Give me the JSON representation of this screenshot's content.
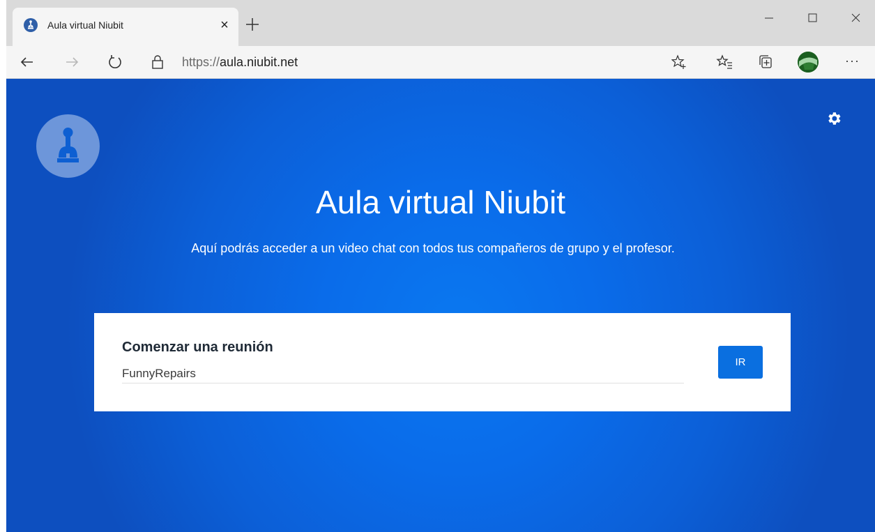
{
  "browser": {
    "tab_title": "Aula virtual Niubit",
    "tab_close": "×",
    "url_scheme": "https://",
    "url_host": "aula.niubit.net",
    "toolbar_more": "···",
    "icons": [
      "tab-favicon-icon",
      "close-icon",
      "plus-icon",
      "minimize-icon",
      "maximize-icon",
      "window-close-icon",
      "back-icon",
      "forward-icon",
      "refresh-icon",
      "lock-icon",
      "add-favorite-icon",
      "favorites-icon",
      "collections-icon",
      "avatar",
      "more-icon"
    ]
  },
  "page": {
    "title": "Aula virtual Niubit",
    "subtitle": "Aquí podrás acceder a un video chat con todos tus compañeros de grupo y el profesor.",
    "start_meeting_label": "Comenzar una reunión",
    "room_name_value": "FunnyRepairs",
    "go_button": "IR",
    "icons": [
      "logo",
      "gear-icon"
    ]
  },
  "colors": {
    "background_center": "#0a78f0",
    "background_edge": "#0d4fbf",
    "button": "#0a6fe0",
    "card": "#ffffff"
  }
}
